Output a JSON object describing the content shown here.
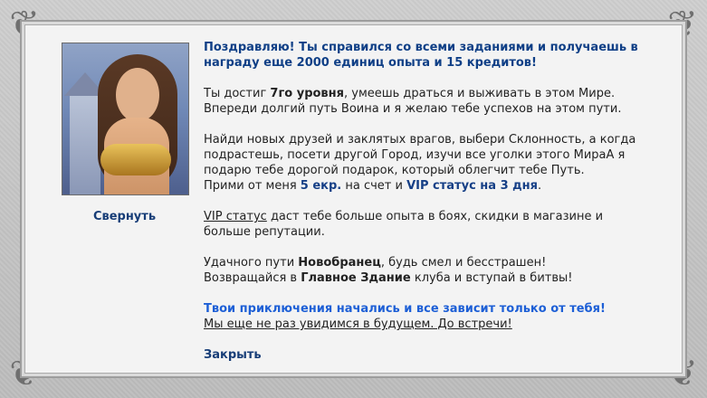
{
  "dialog": {
    "title_line_1": "Поздравляю! Ты справился со всеми заданиями и получаешь в",
    "title_line_2": "награду еще 2000 единиц опыта и 15 кредитов!",
    "level_pre": "Ты достиг ",
    "level_value": "7го уровня",
    "level_post": ", умеешь драться и выживать в этом Мире.",
    "level_line_2": "Впереди долгий путь Воина и я желаю тебе успехов на этом пути.",
    "friends_line_1": "Найди новых друзей и заклятых врагов, выбери Склонность, а когда",
    "friends_line_2": "подрастешь, посети другой Город, изучи все уголки этого МираА я",
    "friends_line_3": "подарю тебе дорогой подарок, который облегчит тебе Путь.",
    "reward_pre": "Прими от меня ",
    "reward_money": "5 екр.",
    "reward_mid": " на счет и ",
    "reward_vip": "VIP статус на 3 дня",
    "reward_post": ".",
    "vip_link": "VIP статус",
    "vip_text_1": " даст тебе больше опыта в боях, скидки в магазине и",
    "vip_text_2": "больше репутации.",
    "luck_pre": "Удачного пути ",
    "luck_name": "Новобранец",
    "luck_post": ", будь смел и бесстрашен!",
    "return_pre": "Возвращайся в ",
    "return_place": "Главное Здание",
    "return_post": " клуба и вступай в битвы!",
    "adventure_line": "Твои приключения начались и все зависит только от тебя!",
    "farewell_line": "Мы еще не раз увидимся в будущем. До встречи!",
    "close_label": "Закрыть",
    "collapse_label": "Свернуть"
  },
  "colors": {
    "title": "#0f3f86",
    "accent": "#1d5fd6",
    "link": "#173d77"
  },
  "portrait": {
    "icon": "warrior-woman-portrait"
  }
}
